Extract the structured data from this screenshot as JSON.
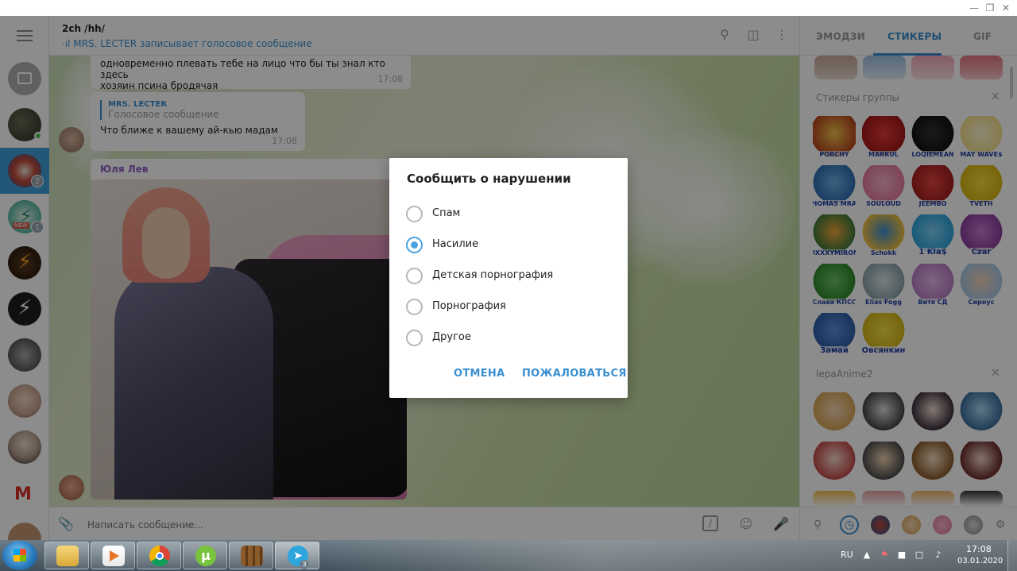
{
  "chat": {
    "title": "2ch /hh/",
    "status": "·ıl MRS. LECTER записывает голосовое сообщение",
    "messages": [
      {
        "text_line1": "одновременно плевать тебе на лицо что бы ты знал кто здесь",
        "text_line2": "хозяин псина бродячая",
        "time": "17:08"
      },
      {
        "reply_name": "MRS. LECTER",
        "reply_text": "Голосовое сообщение",
        "text": "Что ближе к вашему ай-кью мадам",
        "time": "17:08"
      }
    ],
    "photo_author": "Юля Лев",
    "composer_placeholder": "Написать сообщение..."
  },
  "sidebar": {
    "badges": [
      "2",
      "1"
    ],
    "new_label": "NEW"
  },
  "dialog": {
    "title": "Сообщить о нарушении",
    "options": [
      {
        "label": "Спам",
        "checked": false
      },
      {
        "label": "Насилие",
        "checked": true
      },
      {
        "label": "Детская порнография",
        "checked": false
      },
      {
        "label": "Порнография",
        "checked": false
      },
      {
        "label": "Другое",
        "checked": false
      }
    ],
    "cancel_label": "ОТМЕНА",
    "report_label": "ПОЖАЛОВАТЬСЯ"
  },
  "sticker_panel": {
    "tabs": [
      "ЭМОДЗИ",
      "СТИКЕРЫ",
      "GIF"
    ],
    "active_tab": "СТИКЕРЫ",
    "group_title": "Стикеры группы",
    "group_stickers": [
      "PORCHY",
      "MARKUL",
      "LOQIEMEAN",
      "MAY WAVE$",
      "THOMAS MRAZ",
      "SOULOUD",
      "JEEMBO",
      "TVETH",
      "OXXXYMIRON",
      "Schokk",
      "1 Kla$",
      "Czar",
      "Слава КПСС",
      "Elias Fogg",
      "Витя СД",
      "Сирнус",
      "Замай",
      "Овсянкин"
    ],
    "second_title": "lepaAnime2"
  },
  "taskbar": {
    "language": "RU",
    "time": "17:08",
    "date": "03.01.2020",
    "telegram_badge": "3"
  },
  "colors": {
    "accent": "#3a8fd0",
    "active_chat": "#419fd9",
    "author": "#8a5cc1"
  }
}
